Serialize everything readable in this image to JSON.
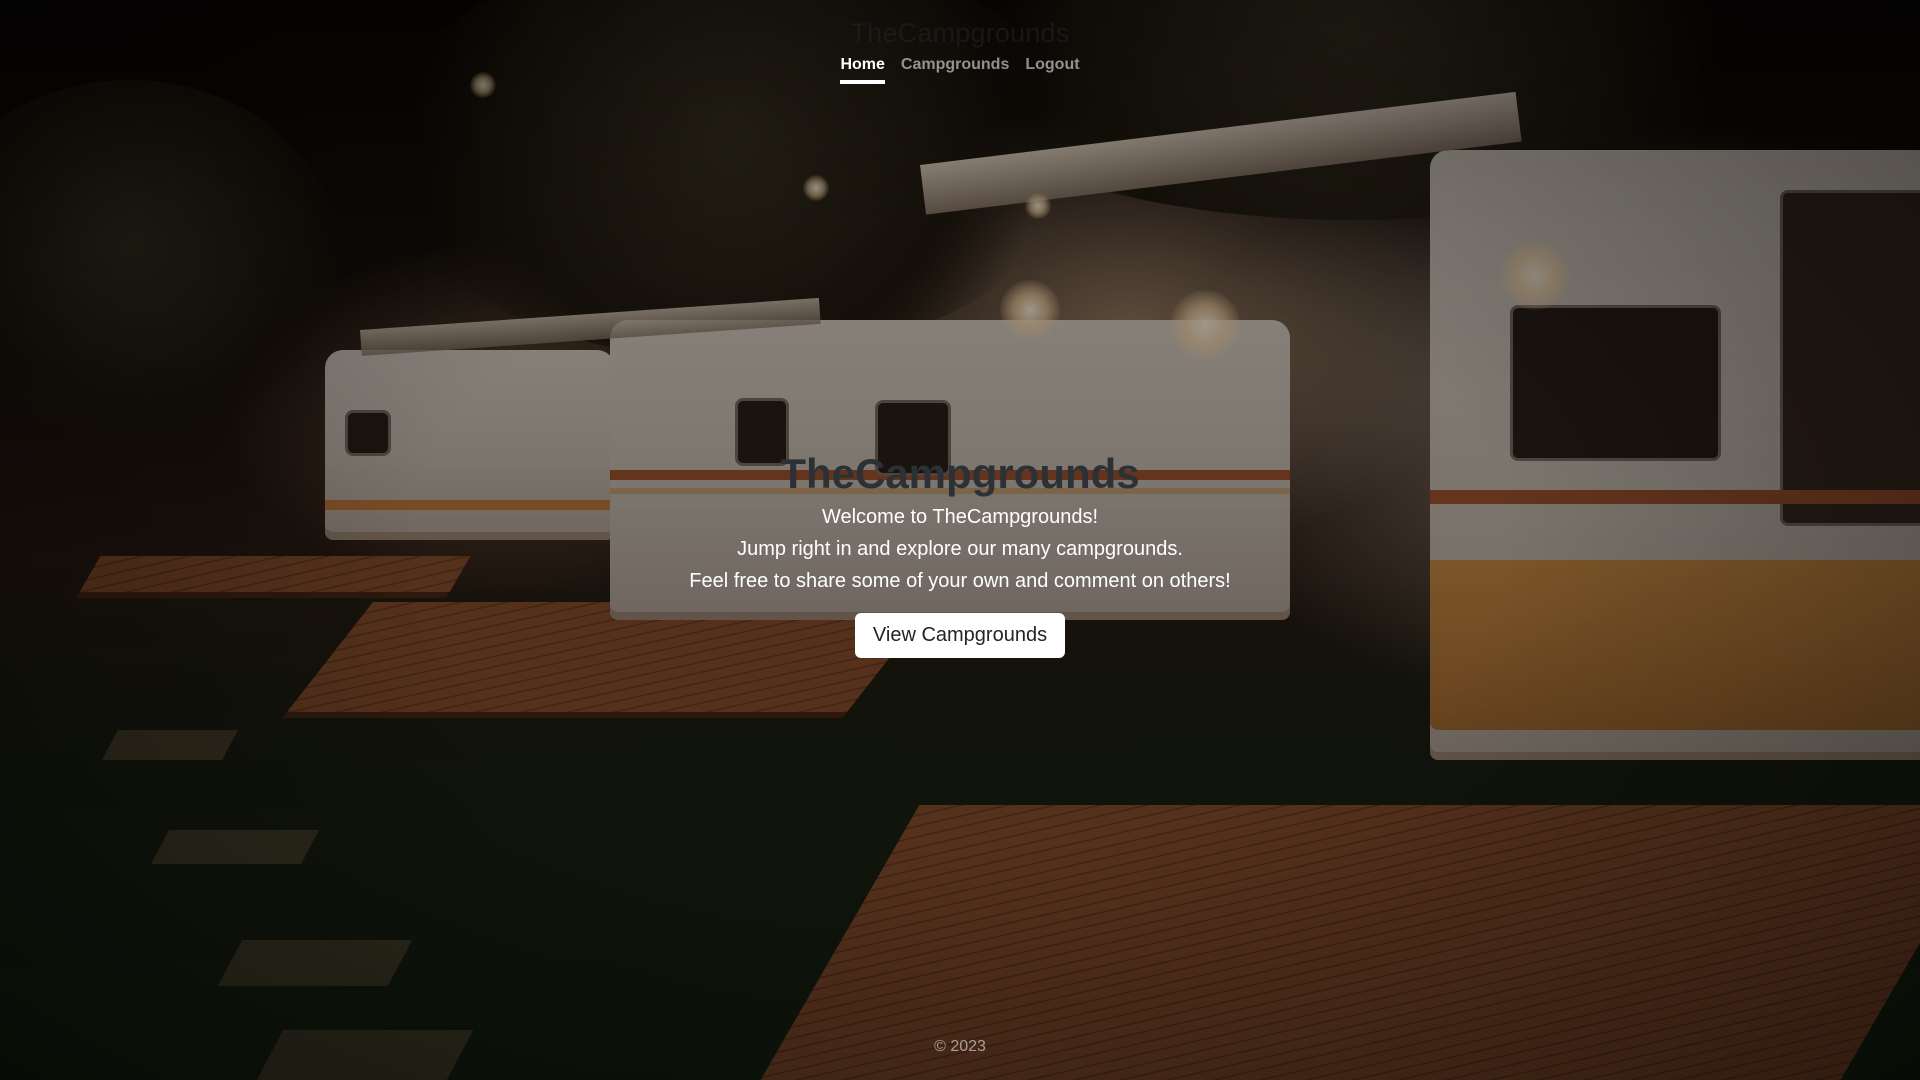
{
  "header": {
    "brand": "TheCampgrounds",
    "nav": [
      {
        "label": "Home",
        "active": true
      },
      {
        "label": "Campgrounds",
        "active": false
      },
      {
        "label": "Logout",
        "active": false
      }
    ]
  },
  "main": {
    "title": "TheCampgrounds",
    "lines": [
      "Welcome to TheCampgrounds!",
      "Jump right in and explore our many campgrounds.",
      "Feel free to share some of your own and comment on others!"
    ],
    "cta_label": "View Campgrounds"
  },
  "footer": {
    "text": "© 2023"
  },
  "colors": {
    "overlay": "#000000",
    "text": "#ffffff",
    "button_bg": "#ffffff",
    "button_text": "#212529",
    "title": "#2c3136"
  }
}
